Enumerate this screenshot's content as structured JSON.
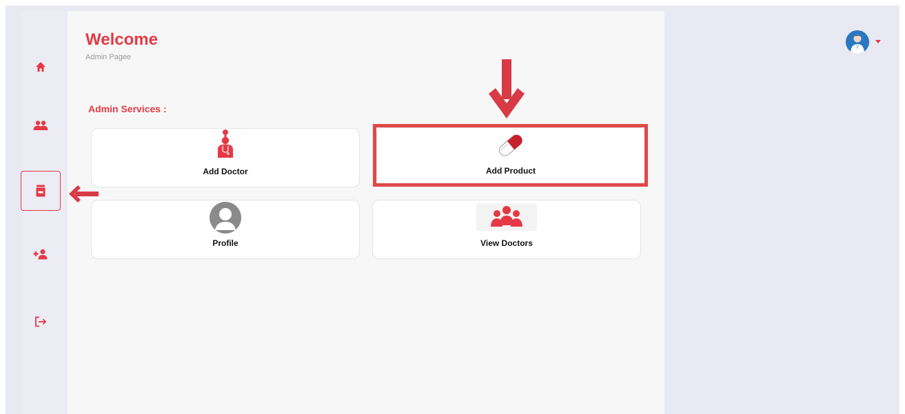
{
  "header": {
    "title": "Welcome",
    "subtitle": "Admin Pagee"
  },
  "sidebar": {
    "items": [
      {
        "name": "home",
        "icon": "home-icon"
      },
      {
        "name": "users",
        "icon": "users-icon"
      },
      {
        "name": "products",
        "icon": "medicine-box-icon",
        "active": true
      },
      {
        "name": "add-user",
        "icon": "add-user-icon"
      },
      {
        "name": "logout",
        "icon": "logout-icon"
      }
    ]
  },
  "services": {
    "title": "Admin Services :",
    "cards": [
      {
        "label": "Add Doctor",
        "icon": "doctor-icon"
      },
      {
        "label": "Add Product",
        "icon": "capsule-icon"
      },
      {
        "label": "Profile",
        "icon": "profile-avatar-icon"
      },
      {
        "label": "View Doctors",
        "icon": "doctors-group-icon"
      }
    ]
  },
  "colors": {
    "accent": "#e53945",
    "annotation": "#d83a46",
    "background": "#e9e9f3",
    "panel": "#f7f7f7"
  }
}
